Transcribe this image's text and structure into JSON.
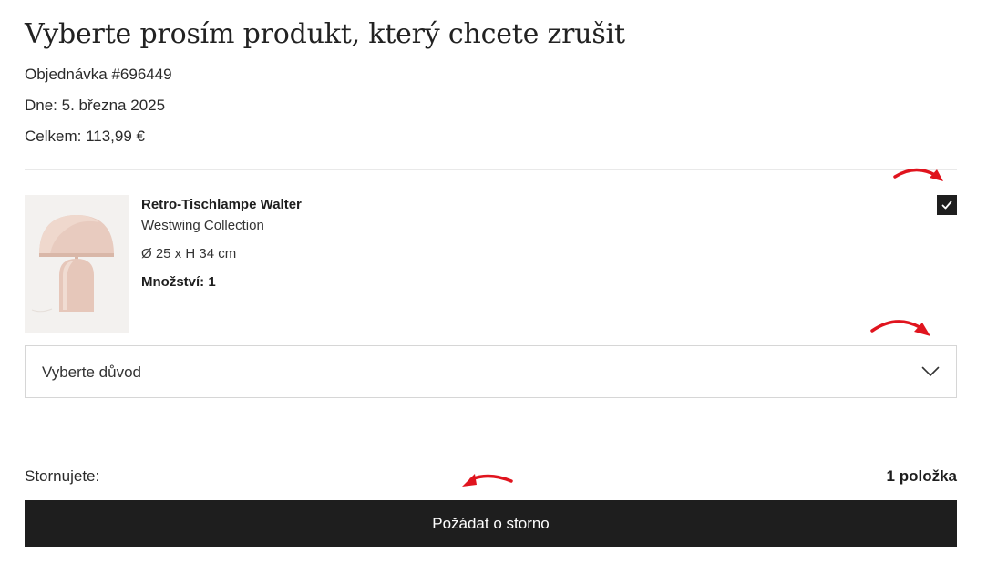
{
  "page": {
    "title": "Vyberte prosím produkt, který chcete zrušit",
    "order_number": "Objednávka #696449",
    "date": "Dne: 5. března 2025",
    "total": "Celkem: 113,99 €"
  },
  "product": {
    "name": "Retro-Tischlampe Walter",
    "brand": "Westwing Collection",
    "dimensions": "Ø 25 x H 34 cm",
    "quantity": "Množství: 1",
    "image_icon": "table-lamp-image",
    "selected": true
  },
  "reason": {
    "label": "Vyberte důvod",
    "icon": "chevron-down-icon"
  },
  "summary": {
    "label": "Stornujete:",
    "count": "1 položka"
  },
  "submit": {
    "label": "Požádat o storno"
  },
  "colors": {
    "primary": "#1e1e1e",
    "annotation": "#e0141e",
    "lamp": "#e8cbbf"
  }
}
